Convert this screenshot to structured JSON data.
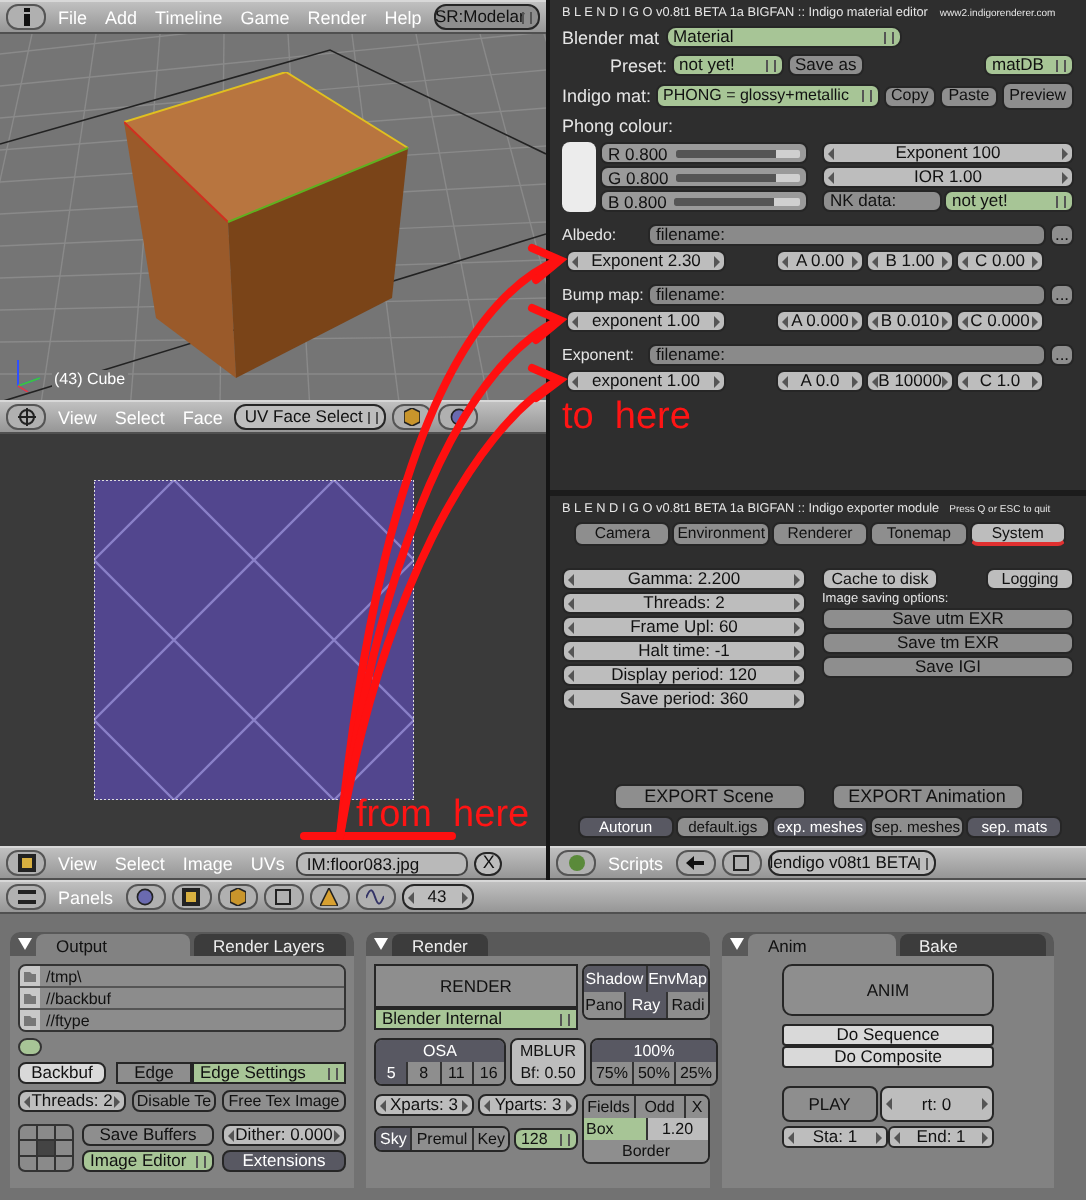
{
  "top_header": {
    "menus": [
      "File",
      "Add",
      "Timeline",
      "Game",
      "Render",
      "Help"
    ],
    "screen": "SR:Modelar"
  },
  "viewport": {
    "object_info": "(43) Cube"
  },
  "viewport_header": {
    "menus": [
      "View",
      "Select",
      "Face"
    ],
    "mode": "UV Face Select"
  },
  "image_editor": {
    "annotation": "from  here"
  },
  "image_header": {
    "menus": [
      "View",
      "Select",
      "Image",
      "UVs"
    ],
    "image": "IM:floor083.jpg",
    "close": "X"
  },
  "material_editor": {
    "title": "B L E N D I G O  v0.8t1 BETA 1a BIGFAN  ::  Indigo material editor",
    "website": "www2.indigorenderer.com",
    "blender_mat": {
      "label": "Blender mat",
      "value": "Material"
    },
    "preset": {
      "label": "Preset:",
      "value": "not yet!"
    },
    "save_as": "Save as",
    "matdb": "matDB",
    "indigo_mat": {
      "label": "Indigo mat:",
      "value": "PHONG = glossy+metallic"
    },
    "actions": [
      "Copy",
      "Paste",
      "Preview"
    ],
    "phong_title": "Phong colour:",
    "channels": [
      {
        "label": "R 0.800",
        "level": 0.8
      },
      {
        "label": "G 0.800",
        "level": 0.8
      },
      {
        "label": "B 0.800",
        "level": 0.8
      }
    ],
    "phong_fields": [
      "Exponent 100",
      "IOR 1.00"
    ],
    "nk": {
      "label": "NK data:",
      "value": "not yet!"
    },
    "maps": [
      {
        "label": "Albedo:",
        "filename": "filename:",
        "browse": "...",
        "params": [
          "Exponent 2.30",
          "A 0.00",
          "B 1.00",
          "C 0.00"
        ]
      },
      {
        "label": "Bump map:",
        "filename": "filename:",
        "browse": "...",
        "params": [
          "exponent 1.00",
          "A 0.000",
          "B 0.010",
          "C 0.000"
        ]
      },
      {
        "label": "Exponent:",
        "filename": "filename:",
        "browse": "...",
        "params": [
          "exponent 1.00",
          "A 0.0",
          "B 10000",
          "C 1.0"
        ]
      }
    ],
    "annotation": "to  here"
  },
  "exporter": {
    "title": "B L E N D I G O  v0.8t1 BETA 1a BIGFAN  ::  Indigo exporter module",
    "hint": "Press Q or ESC to quit",
    "tabs": [
      {
        "label": "Camera",
        "selected": false
      },
      {
        "label": "Environment",
        "selected": false
      },
      {
        "label": "Renderer",
        "selected": false
      },
      {
        "label": "Tonemap",
        "selected": false
      },
      {
        "label": "System",
        "selected": true
      }
    ],
    "settings": [
      "Gamma: 2.200",
      "Threads: 2",
      "Frame Upl: 60",
      "Halt time: -1",
      "Display period: 120",
      "Save period: 360"
    ],
    "toggles": [
      {
        "label": "Cache to disk",
        "on": false
      },
      {
        "label": "Logging",
        "on": false
      }
    ],
    "image_saving_title": "Image saving options:",
    "save_buttons": [
      "Save utm EXR",
      "Save tm EXR",
      "Save IGI"
    ],
    "export_buttons": [
      "EXPORT Scene",
      "EXPORT Animation"
    ],
    "options": [
      {
        "label": "Autorun",
        "on": true
      },
      {
        "label": "default.igs",
        "on": false
      },
      {
        "label": "exp. meshes",
        "on": true
      },
      {
        "label": "sep. meshes",
        "on": false
      },
      {
        "label": "sep. mats",
        "on": true
      }
    ]
  },
  "scripts_header": {
    "label": "Scripts",
    "script": "lendigo v08t1 BETA"
  },
  "buttons_header": {
    "label": "Panels",
    "frame": "43"
  },
  "output_panel": {
    "tabs": [
      {
        "label": "Output",
        "selected": true
      },
      {
        "label": "Render Layers",
        "selected": false
      }
    ],
    "paths": [
      "/tmp\\",
      "//backbuf",
      "//ftype"
    ],
    "backbuf": "Backbuf",
    "edge": "Edge",
    "edge_settings": "Edge Settings",
    "threads": "Threads: 2",
    "disable_tex": "Disable Te",
    "free_tex": "Free Tex Image",
    "save_buffers": "Save Buffers",
    "display": "Image Editor",
    "dither": "Dither: 0.000",
    "extensions": "Extensions"
  },
  "render_panel": {
    "title": "Render",
    "render": "RENDER",
    "engine": "Blender Internal",
    "toggles": [
      {
        "label": "Shadow",
        "on": true
      },
      {
        "label": "EnvMap",
        "on": true
      },
      {
        "label": "Pano",
        "on": false
      },
      {
        "label": "Ray",
        "on": true
      },
      {
        "label": "Radi",
        "on": false
      }
    ],
    "osa": {
      "label": "OSA",
      "options": [
        {
          "label": "5",
          "selected": true
        },
        {
          "label": "8",
          "selected": false
        },
        {
          "label": "11",
          "selected": false
        },
        {
          "label": "16",
          "selected": false
        }
      ]
    },
    "mblur": "MBLUR",
    "blur_factor": "Bf: 0.50",
    "size": {
      "label": "100%",
      "options": [
        {
          "label": "75%",
          "selected": false
        },
        {
          "label": "50%",
          "selected": false
        },
        {
          "label": "25%",
          "selected": false
        }
      ]
    },
    "parts": [
      "Xparts: 3",
      "Yparts: 3"
    ],
    "alpha": [
      {
        "label": "Sky",
        "selected": true
      },
      {
        "label": "Premul",
        "selected": false
      },
      {
        "label": "Key",
        "selected": false
      }
    ],
    "bit_depth": "128",
    "fields": [
      "Fields",
      "Odd",
      "X"
    ],
    "filter": "Box",
    "filter_size": "1.20",
    "border": "Border"
  },
  "anim_panel": {
    "tabs": [
      {
        "label": "Anim",
        "selected": true
      },
      {
        "label": "Bake",
        "selected": false
      }
    ],
    "anim": "ANIM",
    "do_sequence": "Do Sequence",
    "do_composite": "Do Composite",
    "play": "PLAY",
    "rt": "rt: 0",
    "start": "Sta: 1",
    "end": "End: 1"
  }
}
